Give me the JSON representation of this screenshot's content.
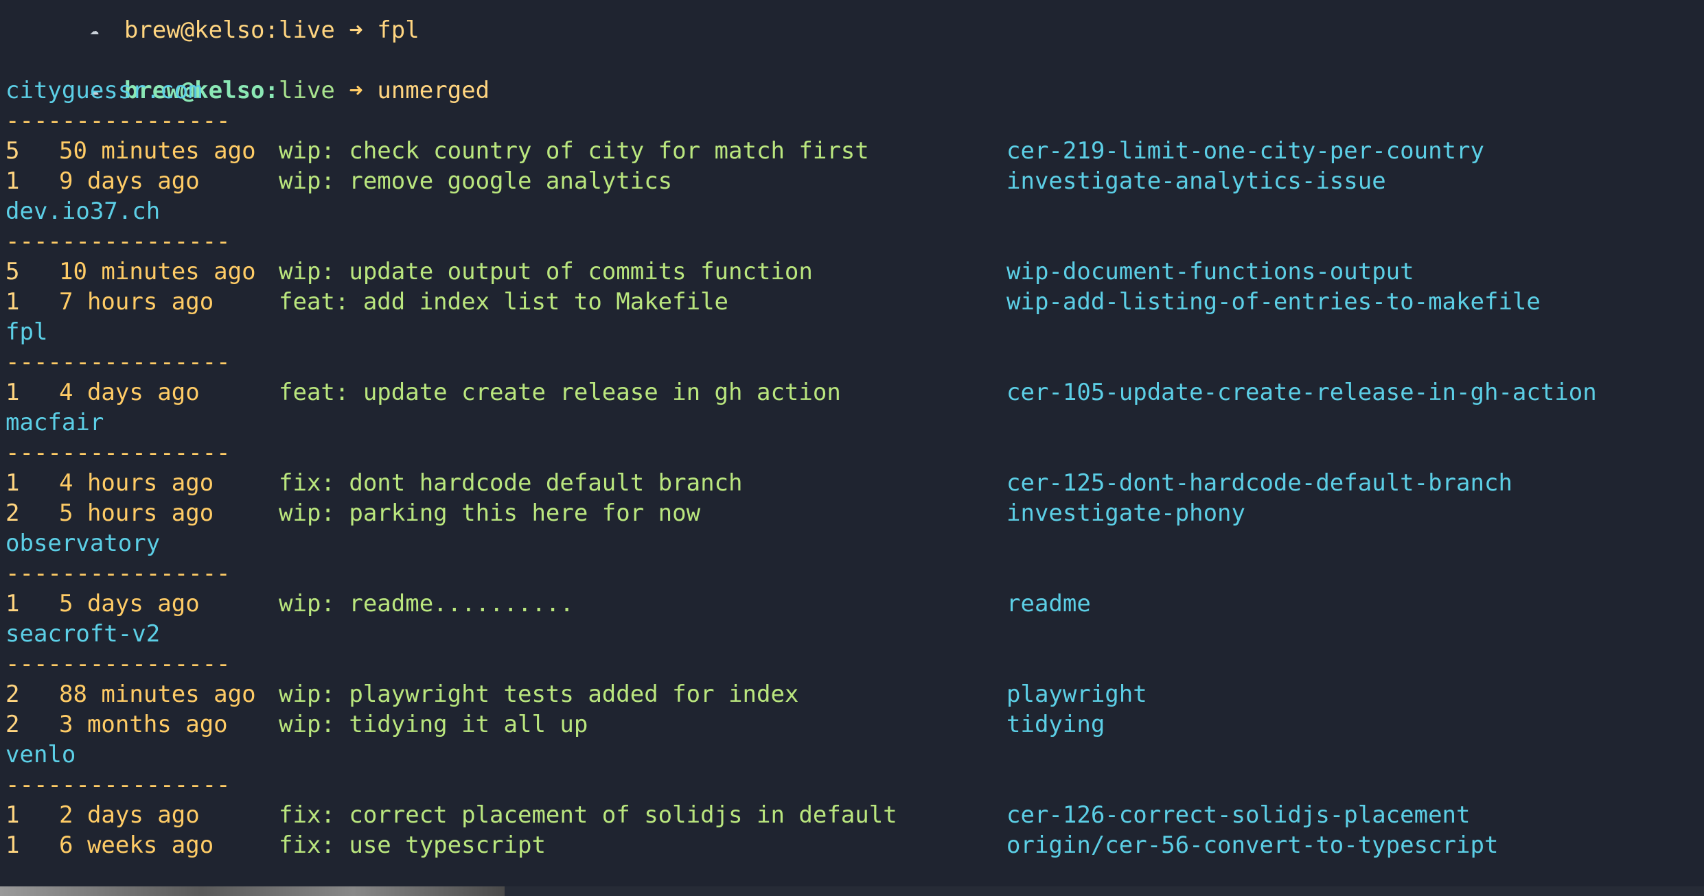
{
  "prompt": {
    "user_host": "brew@kelso",
    "colon": ":",
    "dir": "live",
    "arrow": "➜",
    "command": "unmerged",
    "previous_partial": "brew@kelso:live ➜ fpl"
  },
  "repos": [
    {
      "name": "cityguessr.com",
      "separator": "----------------",
      "rows": [
        {
          "count": "5",
          "time": "50 minutes ago",
          "message": "wip: check country of city for match first",
          "branch": "cer-219-limit-one-city-per-country"
        },
        {
          "count": "1",
          "time": "9 days ago",
          "message": "wip: remove google analytics",
          "branch": "investigate-analytics-issue"
        }
      ]
    },
    {
      "name": "dev.io37.ch",
      "separator": "----------------",
      "rows": [
        {
          "count": "5",
          "time": "10 minutes ago",
          "message": "wip: update output of commits function",
          "branch": "wip-document-functions-output"
        },
        {
          "count": "1",
          "time": "7 hours ago",
          "message": "feat: add index list to Makefile",
          "branch": "wip-add-listing-of-entries-to-makefile"
        }
      ]
    },
    {
      "name": "fpl",
      "separator": "----------------",
      "rows": [
        {
          "count": "1",
          "time": "4 days ago",
          "message": "feat: update create release in gh action",
          "branch": "cer-105-update-create-release-in-gh-action"
        }
      ]
    },
    {
      "name": "macfair",
      "separator": "----------------",
      "rows": [
        {
          "count": "1",
          "time": "4 hours ago",
          "message": "fix: dont hardcode default branch",
          "branch": "cer-125-dont-hardcode-default-branch"
        },
        {
          "count": "2",
          "time": "5 hours ago",
          "message": "wip: parking this here for now",
          "branch": "investigate-phony"
        }
      ]
    },
    {
      "name": "observatory",
      "separator": "----------------",
      "rows": [
        {
          "count": "1",
          "time": "5 days ago",
          "message": "wip: readme..........",
          "branch": "readme"
        }
      ]
    },
    {
      "name": "seacroft-v2",
      "separator": "----------------",
      "rows": [
        {
          "count": "2",
          "time": "88 minutes ago",
          "message": "wip: playwright tests added for index",
          "branch": "playwright"
        },
        {
          "count": "2",
          "time": "3 months ago",
          "message": "wip: tidying it all up",
          "branch": "tidying"
        }
      ]
    },
    {
      "name": "venlo",
      "separator": "----------------",
      "rows": [
        {
          "count": "1",
          "time": "2 days ago",
          "message": "fix: correct placement of solidjs in default",
          "branch": "cer-126-correct-solidjs-placement"
        },
        {
          "count": "1",
          "time": "6 weeks ago",
          "message": "fix: use typescript",
          "branch": "origin/cer-56-convert-to-typescript"
        }
      ]
    }
  ],
  "colors": {
    "background": "#1f2430",
    "user": "#8be8b5",
    "command": "#ffd580",
    "repo": "#5ccfe6",
    "time": "#ffcc66",
    "message": "#bae67e",
    "branch": "#5ccfe6",
    "pink_prompt": "#e9547a",
    "cursor": "#f07858"
  }
}
